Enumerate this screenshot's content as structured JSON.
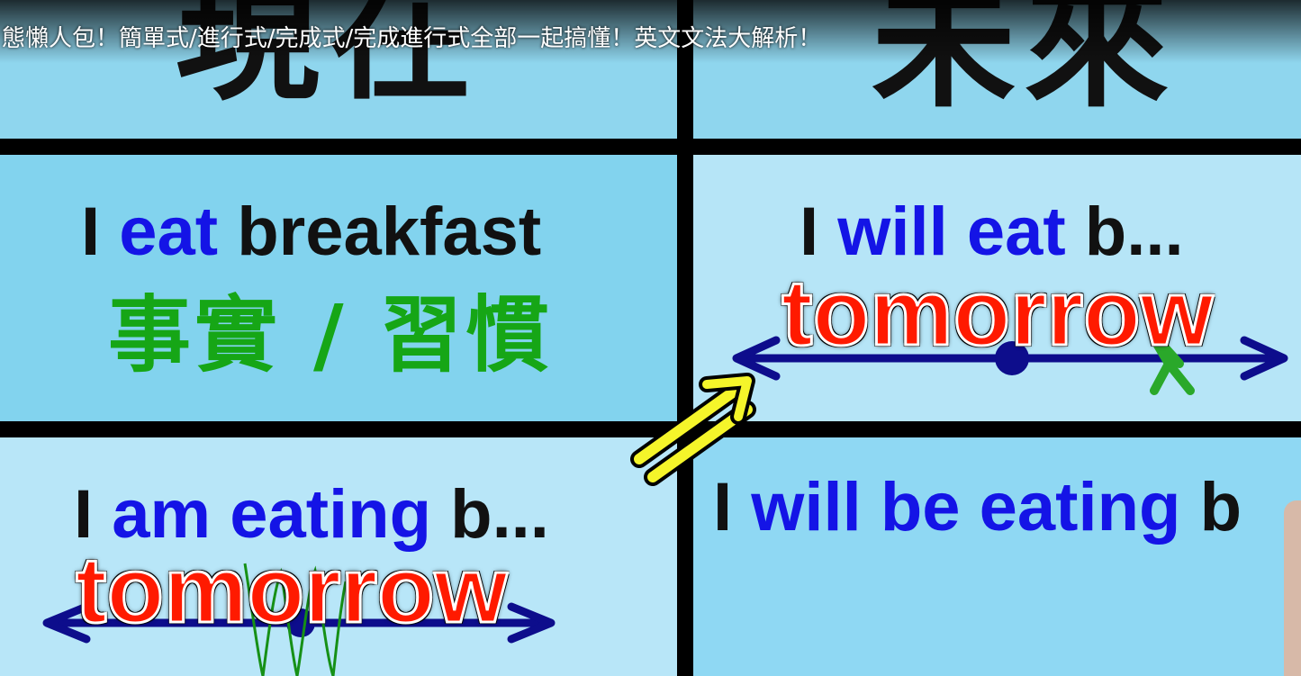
{
  "video": {
    "title": "態懶人包！簡單式/進行式/完成式/完成進行式全部一起搞懂！英文文法大解析！"
  },
  "grid": {
    "col_present": "現在",
    "col_future": "未來",
    "present_simple": {
      "subject": "I",
      "verb": "eat",
      "object": "breakfast"
    },
    "present_simple_note": "事實 / 習慣",
    "future_simple": {
      "subject": "I",
      "verb": "will eat",
      "object": "b..."
    },
    "future_simple_time": "tomorrow",
    "present_progressive": {
      "subject": "I",
      "verb": "am eating",
      "object": "b..."
    },
    "present_progressive_time": "tomorrow",
    "future_progressive": {
      "subject": "I",
      "verb": "will be eating",
      "object": "b"
    }
  },
  "colors": {
    "verb_blue": "#1414e6",
    "note_green": "#16a616",
    "time_red": "#ff1a00",
    "timeline_navy": "#0d0d8c",
    "arrow_yellow": "#f5f52a"
  }
}
